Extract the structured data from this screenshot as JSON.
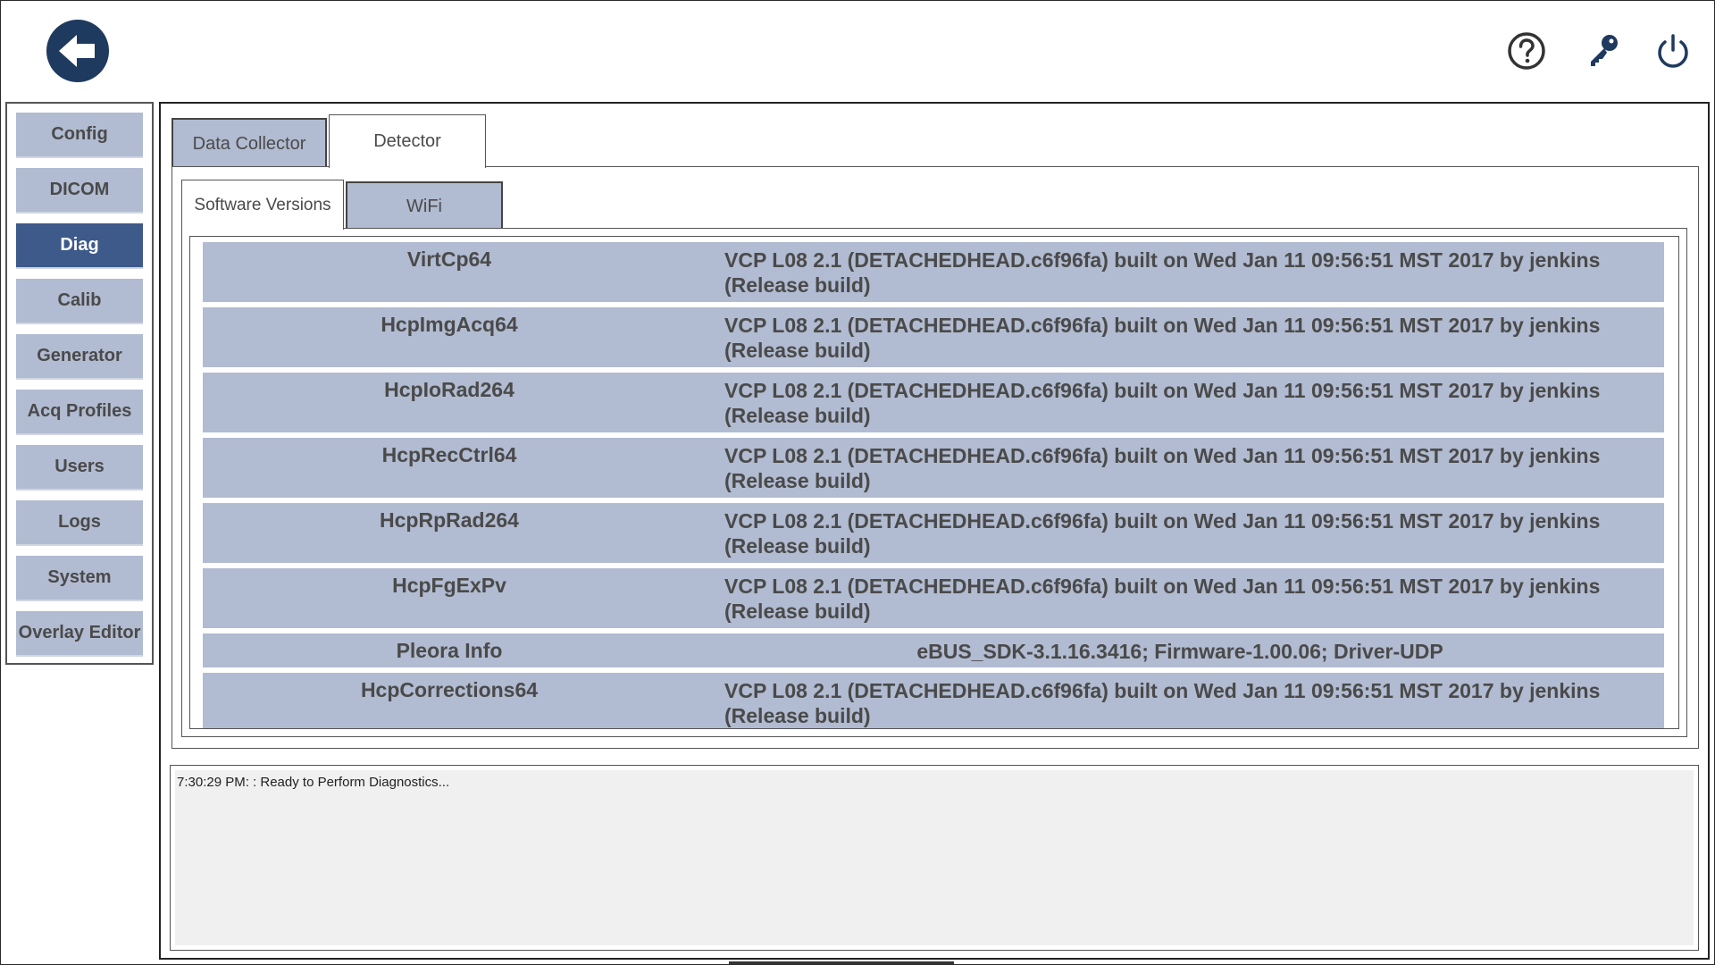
{
  "header": {
    "back_icon": "back-arrow-icon",
    "help_icon": "help-icon",
    "key_icon": "key-icon",
    "power_icon": "power-icon",
    "accent_color": "#1f3a5f"
  },
  "sidebar": {
    "items": [
      {
        "label": "Config"
      },
      {
        "label": "DICOM"
      },
      {
        "label": "Diag",
        "active": true
      },
      {
        "label": "Calib"
      },
      {
        "label": "Generator"
      },
      {
        "label": "Acq Profiles"
      },
      {
        "label": "Users"
      },
      {
        "label": "Logs"
      },
      {
        "label": "System"
      },
      {
        "label": "Overlay Editor"
      }
    ],
    "active_color": "#3d5a8a",
    "inactive_color": "#b1bbd1"
  },
  "tabs": [
    {
      "label": "Data Collector",
      "active": false
    },
    {
      "label": "Detector",
      "active": true
    }
  ],
  "subtabs": [
    {
      "label": "Software Versions",
      "active": true
    },
    {
      "label": "WiFi",
      "active": false
    }
  ],
  "versions": [
    {
      "name": "VirtCp64",
      "value_line1": "VCP L08 2.1 (DETACHEDHEAD.c6f96fa) built on Wed Jan 11 09:56:51 MST 2017 by jenkins",
      "value_line2": "(Release build)"
    },
    {
      "name": "HcpImgAcq64",
      "value_line1": "VCP L08 2.1 (DETACHEDHEAD.c6f96fa) built on Wed Jan 11 09:56:51 MST 2017 by jenkins",
      "value_line2": "(Release build)"
    },
    {
      "name": "HcpIoRad264",
      "value_line1": "VCP L08 2.1 (DETACHEDHEAD.c6f96fa) built on Wed Jan 11 09:56:51 MST 2017 by jenkins",
      "value_line2": "(Release build)"
    },
    {
      "name": "HcpRecCtrl64",
      "value_line1": "VCP L08 2.1 (DETACHEDHEAD.c6f96fa) built on Wed Jan 11 09:56:51 MST 2017 by jenkins",
      "value_line2": "(Release build)"
    },
    {
      "name": "HcpRpRad264",
      "value_line1": "VCP L08 2.1 (DETACHEDHEAD.c6f96fa) built on Wed Jan 11 09:56:51 MST 2017 by jenkins",
      "value_line2": "(Release build)"
    },
    {
      "name": "HcpFgExPv",
      "value_line1": "VCP L08 2.1 (DETACHEDHEAD.c6f96fa) built on Wed Jan 11 09:56:51 MST 2017 by jenkins",
      "value_line2": "(Release build)"
    },
    {
      "name": "Pleora Info",
      "value_line1": "eBUS_SDK-3.1.16.3416;  Firmware-1.00.06;  Driver-UDP",
      "value_line2": ""
    },
    {
      "name": "HcpCorrections64",
      "value_line1": "VCP L08 2.1 (DETACHEDHEAD.c6f96fa) built on Wed Jan 11 09:56:51 MST 2017 by jenkins",
      "value_line2": "(Release build)"
    }
  ],
  "log": {
    "text": "7:30:29 PM: : Ready to Perform Diagnostics..."
  }
}
